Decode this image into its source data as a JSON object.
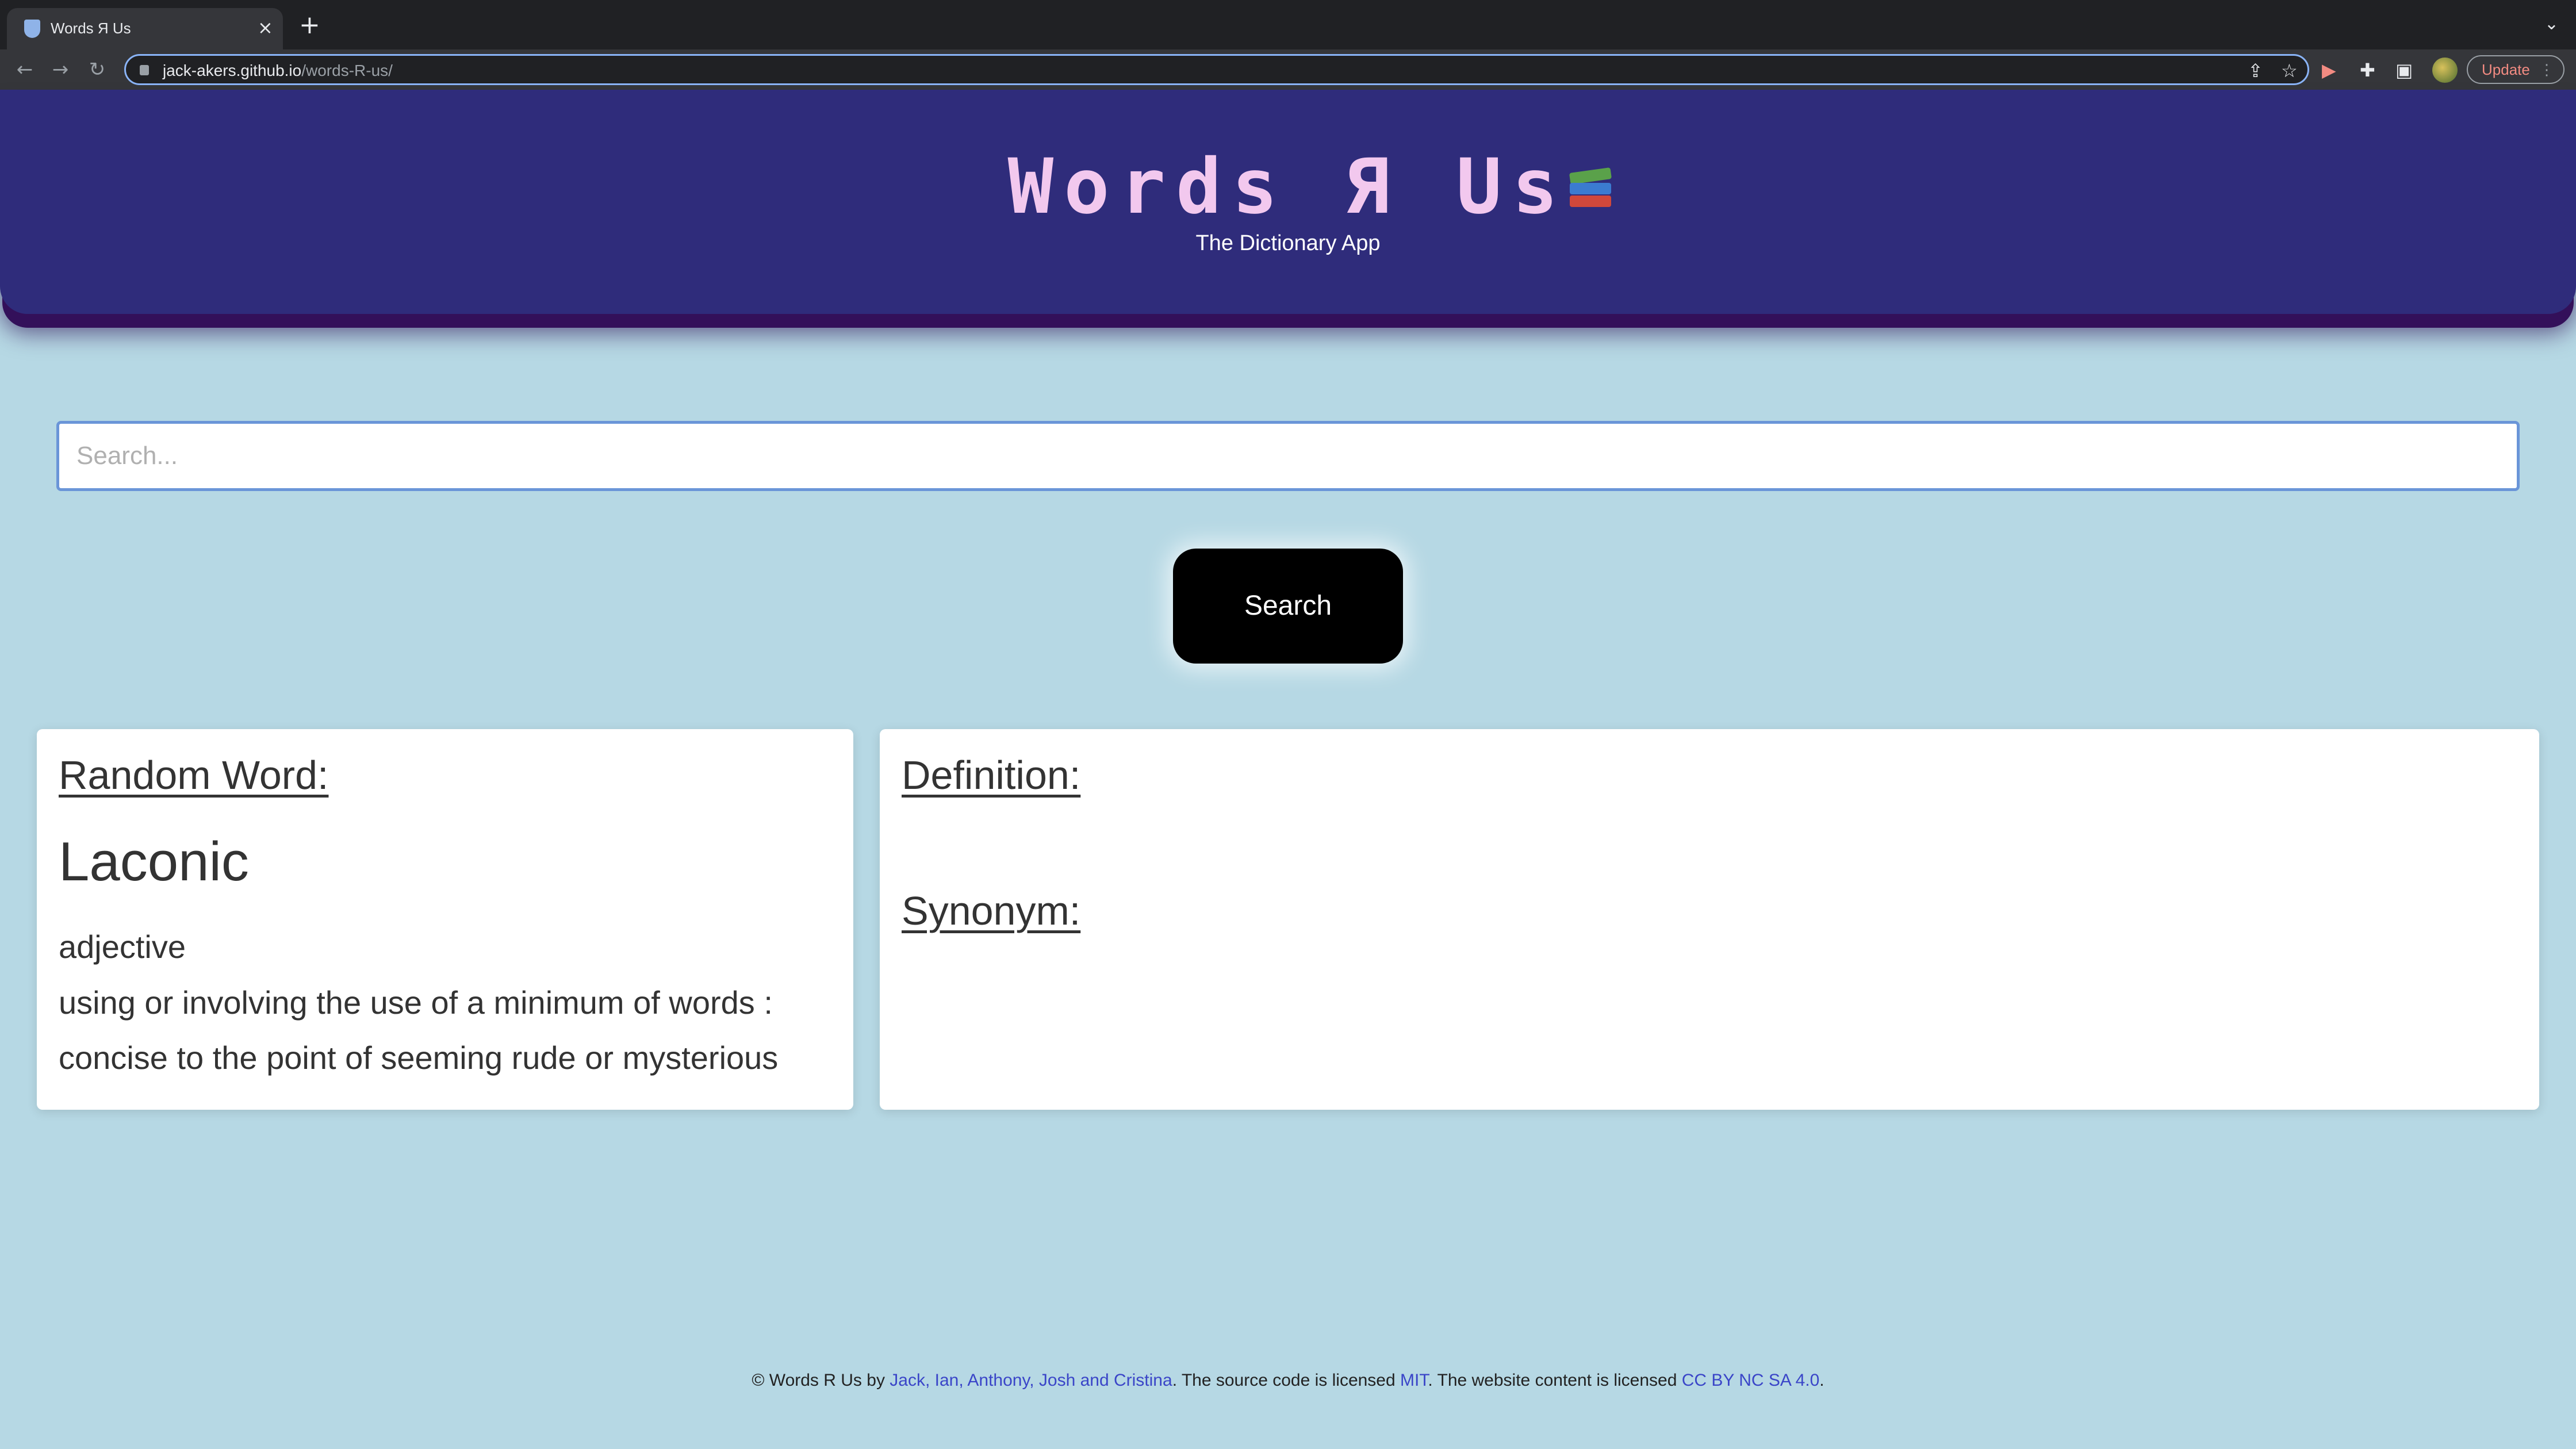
{
  "browser": {
    "tab_title": "Words Я Us",
    "url_host": "jack-akers.github.io",
    "url_path": "/words-R-us/",
    "update_label": "Update"
  },
  "header": {
    "title": "Words Я Us",
    "subtitle": "The Dictionary App"
  },
  "search": {
    "placeholder": "Search...",
    "value": "",
    "button_label": "Search"
  },
  "random_word": {
    "heading": "Random Word:",
    "word": "Laconic",
    "part_of_speech": "adjective",
    "definition": "using or involving the use of a minimum of words : concise to the point of seeming rude or mysterious"
  },
  "definition_panel": {
    "definition_heading": "Definition:",
    "synonym_heading": "Synonym:"
  },
  "footer": {
    "prefix": "© Words R Us by",
    "authors": "Jack, Ian, Anthony, Josh and Cristina",
    "mid1": ". The source code is licensed",
    "code_license": "MIT",
    "mid2": ". The website content is licensed",
    "content_license": "CC BY NC SA 4.0",
    "end": "."
  },
  "colors": {
    "page_background": "#b6d8e4",
    "header_background": "#2f2c7b",
    "title_color": "#f2c8ee",
    "link_color": "#3a45c8"
  },
  "icons": [
    "favicon-icon",
    "close-icon",
    "new-tab-icon",
    "back-icon",
    "forward-icon",
    "reload-icon",
    "lock-icon",
    "share-icon",
    "star-icon",
    "extension-icon",
    "puzzle-icon",
    "sidebar-icon",
    "books-icon"
  ]
}
